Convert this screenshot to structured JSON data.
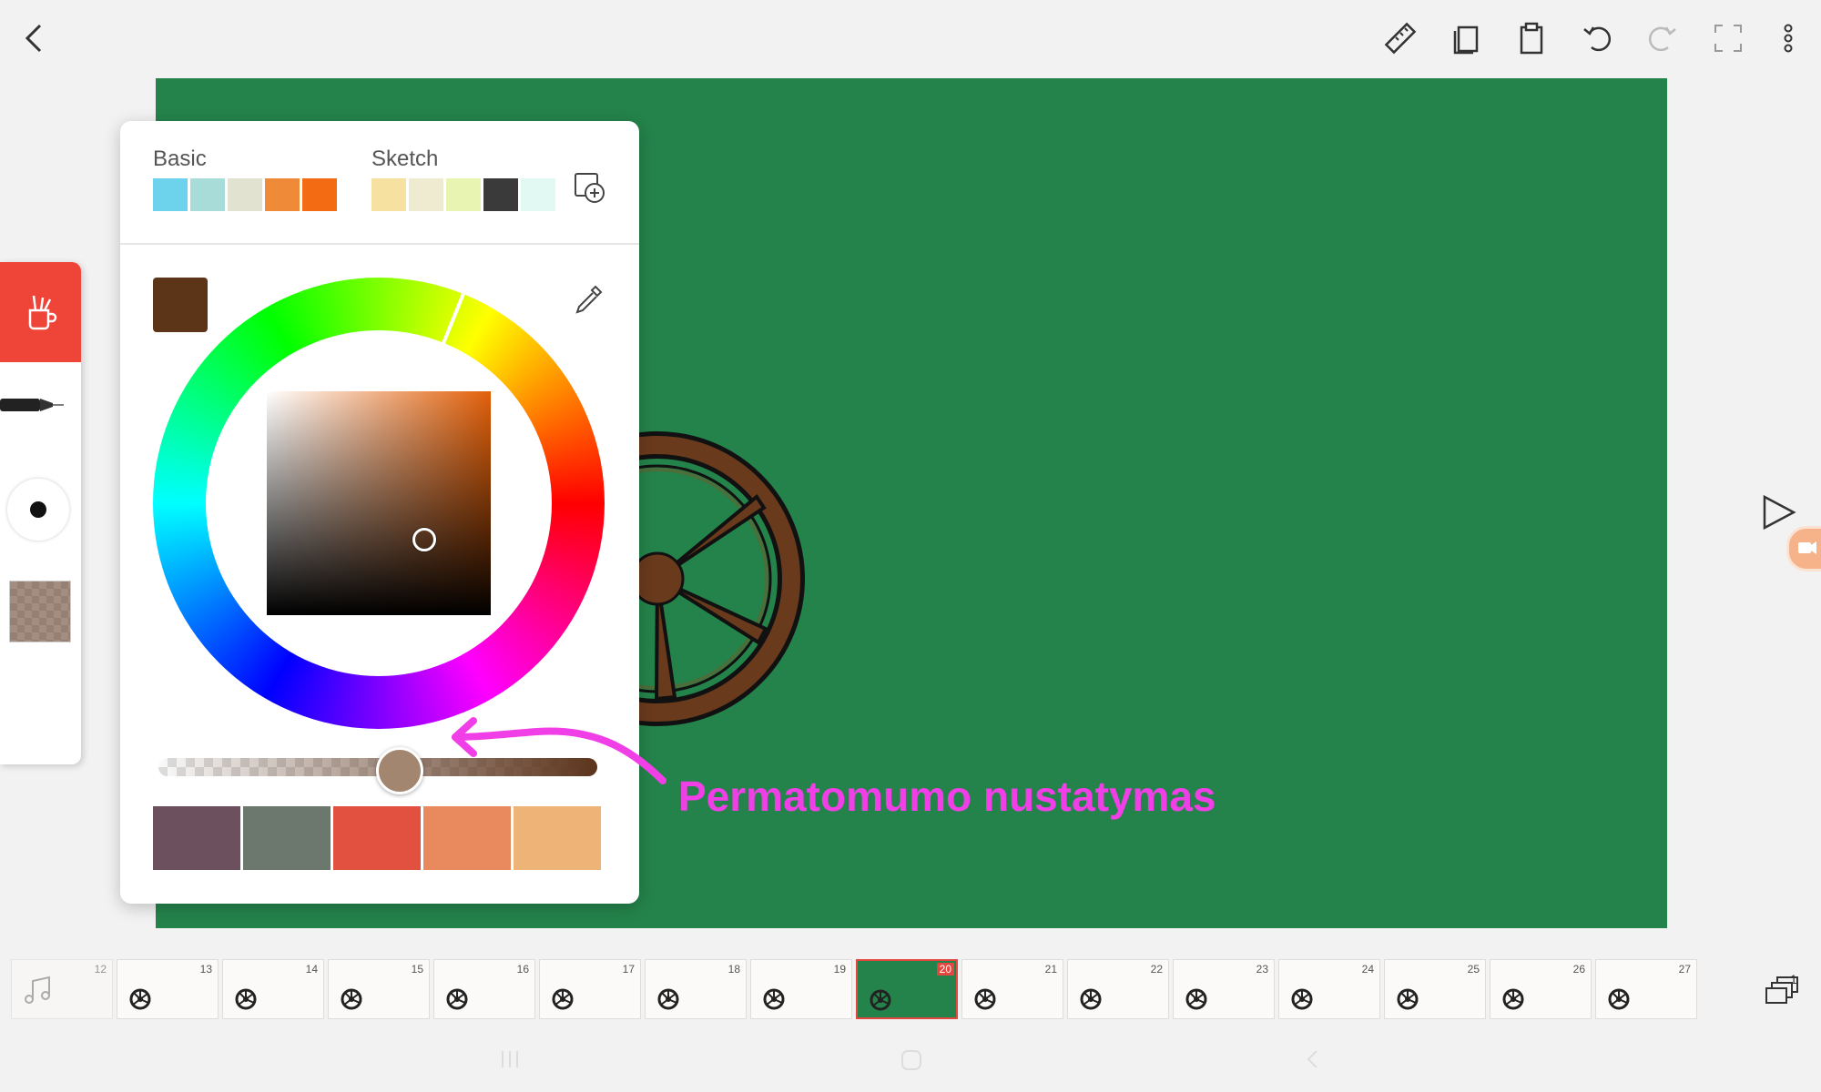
{
  "toolbar": {
    "back_icon": "back-arrow-icon",
    "icons": [
      "ruler-icon",
      "copy-frame-icon",
      "paste-icon",
      "undo-icon",
      "redo-icon",
      "fullscreen-icon",
      "more-vert-icon"
    ]
  },
  "color_picker": {
    "palettes": [
      {
        "title": "Basic",
        "colors": [
          "#6dd3ec",
          "#a7dcd8",
          "#e1e2cf",
          "#ef8a39",
          "#f36b12"
        ]
      },
      {
        "title": "Sketch",
        "colors": [
          "#f7e1a0",
          "#eeebd1",
          "#e8f4b2",
          "#3a3a3a",
          "#e2f8f3"
        ]
      }
    ],
    "current_color": "#5c3418",
    "opacity_percent": 55,
    "hue_degrees": 22,
    "recent_colors": [
      "#6d505d",
      "#6c786e",
      "#e25140",
      "#e88a5e",
      "#eeb376"
    ]
  },
  "annotation": {
    "text": "Permatomumo nustatymas",
    "color": "#f03fe6"
  },
  "timeline": {
    "frames": [
      "12",
      "13",
      "14",
      "15",
      "16",
      "17",
      "18",
      "19",
      "20",
      "21",
      "22",
      "23",
      "24",
      "25",
      "26",
      "27"
    ],
    "active_frame": "20",
    "layers_badge": "1"
  },
  "colors": {
    "canvas_bg": "#24834a",
    "accent": "#ef4438",
    "wheel_brown": "#6a3a1c"
  }
}
